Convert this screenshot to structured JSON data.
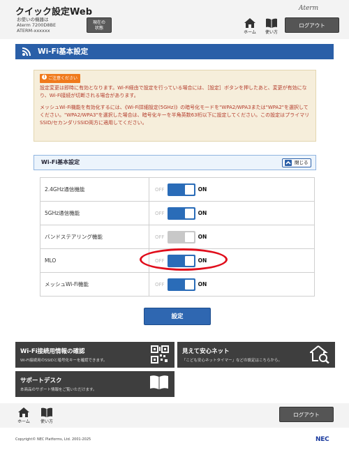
{
  "header": {
    "title": "クイック設定Web",
    "device_lines": [
      "お使いの機器は",
      "Aterm 7200D8BE",
      "ATERM-xxxxxx"
    ],
    "status_button": [
      "現在の",
      "状態"
    ],
    "brand": "Aterm",
    "home_label": "ホーム",
    "help_label": "使い方",
    "logout_label": "ログアウト"
  },
  "page_title": "Wi-Fi基本設定",
  "notice": {
    "badge": "ご注意ください",
    "para1": "設定変更は即時に有効となります。Wi-Fi経由で設定を行っている場合には、［設定］ボタンを押したあと、変更が有効になり、Wi-Fi接続が切断される場合があります。",
    "para2": "メッシュWi-Fi機能を有効化するには、《Wi-Fi詳細設定(5GHz)》の暗号化モードを\"WPA2/WPA3または\"WPA2\"を選択してください。\"WPA2/WPA3\"を選択した場合は、暗号化キーを半角英数63桁以下に設定してください。この設定はプライマリSSID/セカンダリSSID両方に適用してください。"
  },
  "section": {
    "title": "Wi-Fi基本設定",
    "close_label": "閉じる"
  },
  "toggle_labels": {
    "off": "OFF",
    "on": "ON"
  },
  "settings": [
    {
      "label": "2.4GHz通信機能",
      "state": "ON",
      "enabled": true
    },
    {
      "label": "5GHz通信機能",
      "state": "ON",
      "enabled": true
    },
    {
      "label": "バンドステアリング機能",
      "state": "ON",
      "enabled": false
    },
    {
      "label": "MLO",
      "state": "ON",
      "enabled": true
    },
    {
      "label": "メッシュWi-Fi機能",
      "state": "ON",
      "enabled": true
    }
  ],
  "apply_label": "設定",
  "tiles": {
    "wifi_info": {
      "title": "Wi-Fi接続用情報の確認",
      "desc": "Wi-Fi接続用のSSIDと暗号化キーを確認できます。"
    },
    "safety": {
      "title": "見えて安心ネット",
      "desc": "「こども安心ネットタイマー」などの設定はこちらから。"
    },
    "support": {
      "title": "サポートデスク",
      "desc": "本商品のサポート情報をご覧いただけます。"
    }
  },
  "footer": {
    "home_label": "ホーム",
    "help_label": "使い方",
    "logout_label": "ログアウト",
    "copyright": "Copyright© NEC Platforms, Ltd. 2001-2025",
    "nec": "NEC"
  },
  "colors": {
    "accent": "#2a5fa8",
    "toggle_on": "#2a6cb8",
    "notice_text": "#b33a2a",
    "highlight": "#e00d1b"
  }
}
